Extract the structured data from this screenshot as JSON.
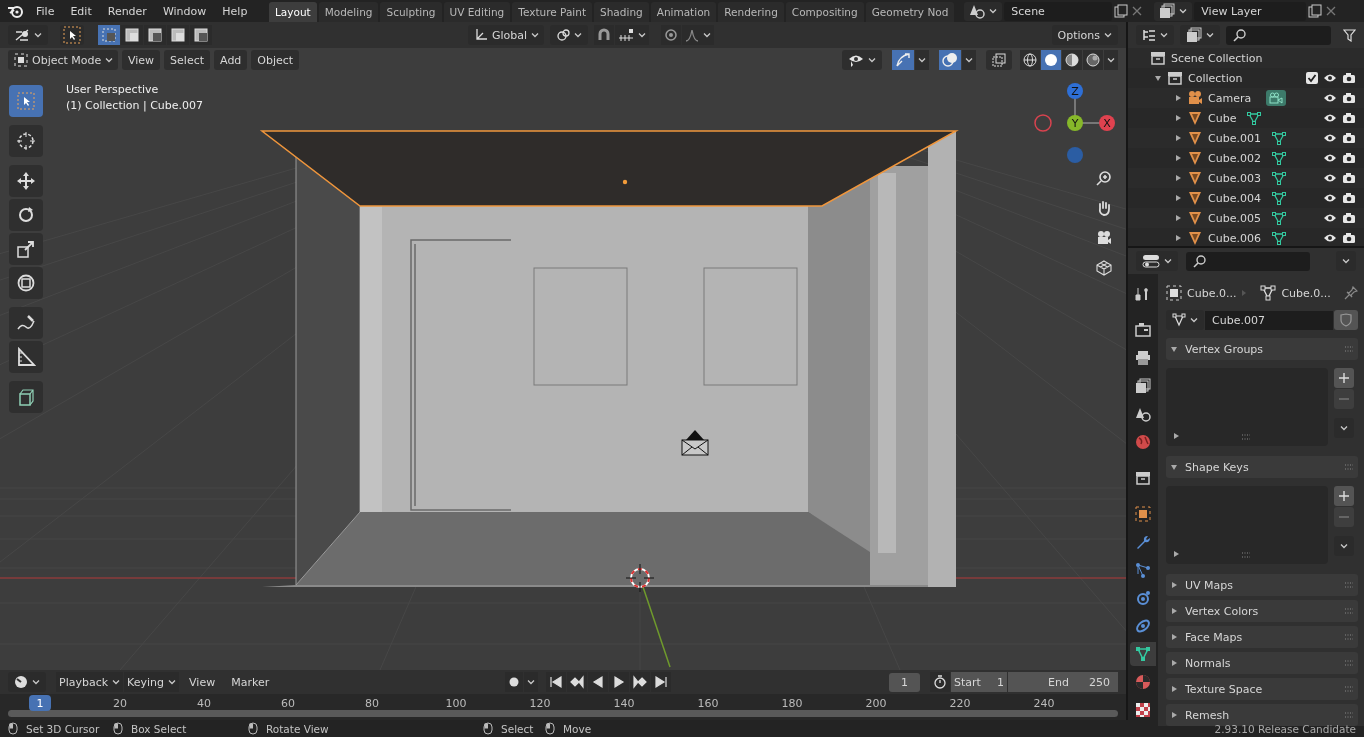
{
  "menu": [
    "File",
    "Edit",
    "Render",
    "Window",
    "Help"
  ],
  "workspaces": [
    {
      "label": "Layout",
      "selected": true
    },
    {
      "label": "Modeling",
      "selected": false
    },
    {
      "label": "Sculpting",
      "selected": false
    },
    {
      "label": "UV Editing",
      "selected": false
    },
    {
      "label": "Texture Paint",
      "selected": false
    },
    {
      "label": "Shading",
      "selected": false
    },
    {
      "label": "Animation",
      "selected": false
    },
    {
      "label": "Rendering",
      "selected": false
    },
    {
      "label": "Compositing",
      "selected": false
    },
    {
      "label": "Geometry Nod",
      "selected": false
    }
  ],
  "scene": "Scene",
  "view_layer": "View Layer",
  "tool_header": {
    "select_modes": [
      {
        "selected": true
      },
      {
        "selected": false
      },
      {
        "selected": false
      },
      {
        "selected": false
      },
      {
        "selected": false
      }
    ],
    "orientation": "Global",
    "options": "Options"
  },
  "viewport": {
    "mode": "Object Mode",
    "menus": [
      "View",
      "Select",
      "Add",
      "Object"
    ],
    "shading": [
      {
        "kind": "wireframe",
        "selected": false
      },
      {
        "kind": "solid",
        "selected": true
      },
      {
        "kind": "material",
        "selected": false
      },
      {
        "kind": "rendered",
        "selected": false
      }
    ],
    "view_name": "User Perspective",
    "collection_info": "(1) Collection | Cube.007",
    "tools": [
      {
        "kind": "select",
        "selected": true
      },
      {
        "kind": "cursor",
        "selected": false
      },
      {
        "kind": "move",
        "selected": false
      },
      {
        "kind": "rotate",
        "selected": false
      },
      {
        "kind": "scale",
        "selected": false
      },
      {
        "kind": "transform",
        "selected": false
      },
      {
        "kind": "annotate",
        "selected": false
      },
      {
        "kind": "measure",
        "selected": false
      },
      {
        "kind": "add_cube",
        "selected": false
      }
    ],
    "gizmo": {
      "z": "Z",
      "y": "Y",
      "x": "X"
    }
  },
  "outliner": {
    "root": "Scene Collection",
    "collections": [
      {
        "label": "Collection",
        "checked": true,
        "expanded": true,
        "children": [
          {
            "label": "Camera",
            "kind": "camera",
            "expanded": false
          },
          {
            "label": "Cube",
            "kind": "mesh",
            "expanded": false
          },
          {
            "label": "Cube.001",
            "kind": "mesh",
            "expanded": false
          },
          {
            "label": "Cube.002",
            "kind": "mesh",
            "expanded": false
          },
          {
            "label": "Cube.003",
            "kind": "mesh",
            "expanded": false
          },
          {
            "label": "Cube.004",
            "kind": "mesh",
            "expanded": false
          },
          {
            "label": "Cube.005",
            "kind": "mesh",
            "expanded": false
          },
          {
            "label": "Cube.006",
            "kind": "mesh",
            "expanded": false
          }
        ]
      }
    ]
  },
  "properties": {
    "tabs": [
      {
        "kind": "tool",
        "selected": false
      },
      {
        "kind": "render",
        "selected": false
      },
      {
        "kind": "output",
        "selected": false
      },
      {
        "kind": "view_layer",
        "selected": false
      },
      {
        "kind": "scene",
        "selected": false
      },
      {
        "kind": "world",
        "selected": false
      },
      {
        "kind": "collection",
        "selected": false
      },
      {
        "kind": "object",
        "selected": false
      },
      {
        "kind": "modifiers",
        "selected": false
      },
      {
        "kind": "particles",
        "selected": false
      },
      {
        "kind": "physics",
        "selected": false
      },
      {
        "kind": "constraints",
        "selected": false
      },
      {
        "kind": "data",
        "selected": true
      },
      {
        "kind": "material",
        "selected": false
      },
      {
        "kind": "texture",
        "selected": false
      }
    ],
    "breadcrumb": [
      "Cube.0...",
      "Cube.0..."
    ],
    "mesh_name": "Cube.007",
    "panels": [
      {
        "title": "Vertex Groups",
        "expanded": true
      },
      {
        "title": "Shape Keys",
        "expanded": true
      },
      {
        "title": "UV Maps",
        "expanded": false
      },
      {
        "title": "Vertex Colors",
        "expanded": false
      },
      {
        "title": "Face Maps",
        "expanded": false
      },
      {
        "title": "Normals",
        "expanded": false
      },
      {
        "title": "Texture Space",
        "expanded": false
      },
      {
        "title": "Remesh",
        "expanded": false
      }
    ]
  },
  "timeline": {
    "menus": [
      "Playback",
      "Keying",
      "View",
      "Marker"
    ],
    "current_frame": "1",
    "start_label": "Start",
    "start": "1",
    "end_label": "End",
    "end": "250",
    "playhead": "1",
    "ticks": [
      "20",
      "40",
      "60",
      "80",
      "100",
      "120",
      "140",
      "160",
      "180",
      "200",
      "220",
      "240"
    ]
  },
  "status_bar": {
    "hints": [
      "Set 3D Cursor",
      "Box Select",
      "Rotate View",
      "Select",
      "Move"
    ],
    "version": "2.93.10 Release Candidate"
  }
}
